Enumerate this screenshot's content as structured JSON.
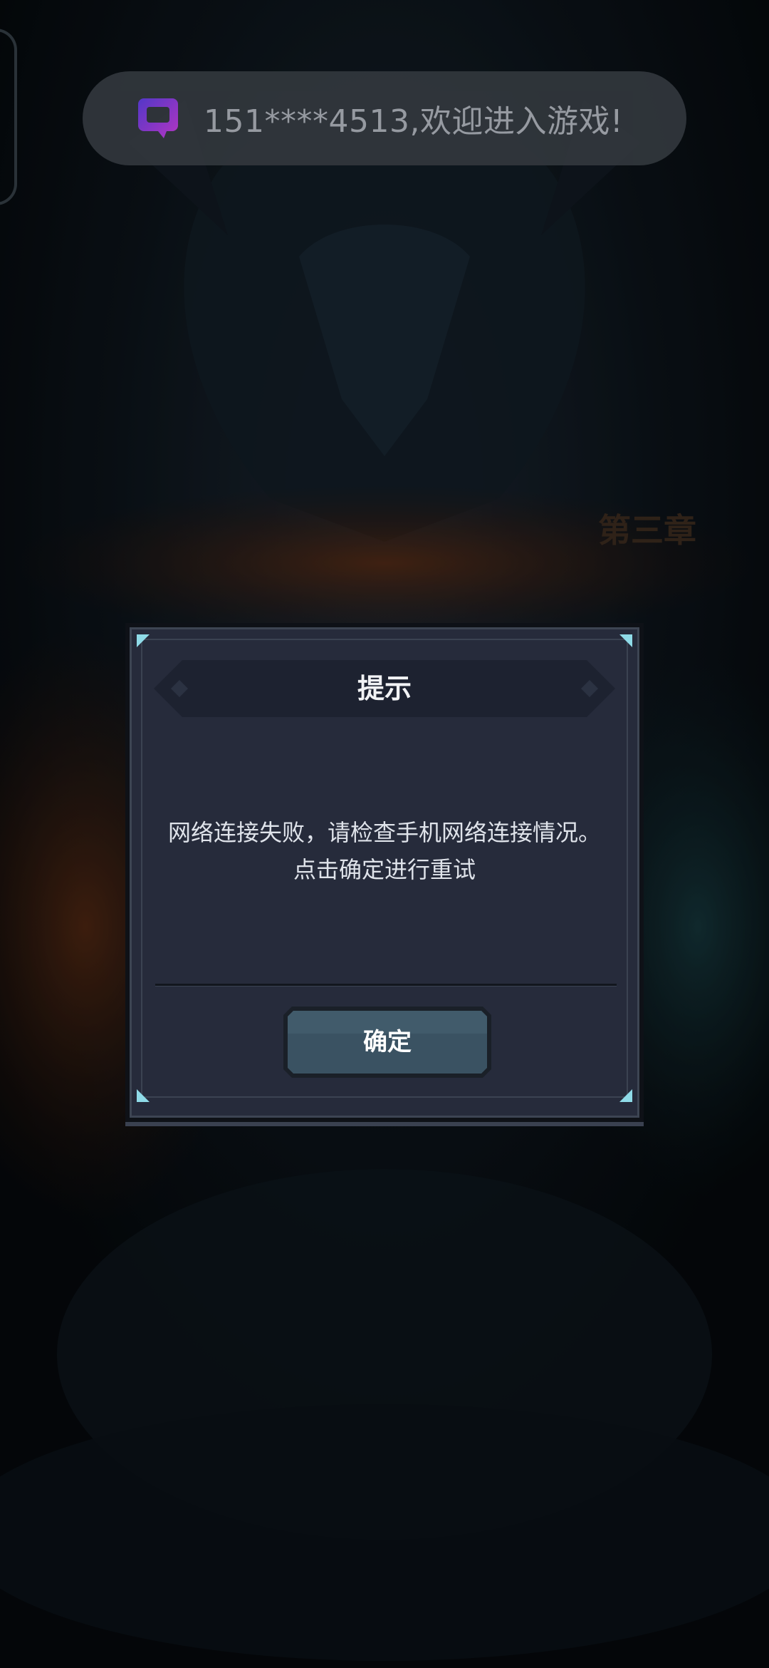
{
  "toast": {
    "message": "151****4513,欢迎进入游戏!",
    "logo_icon": "q-logo-icon",
    "colors": {
      "background": "#32373d",
      "text": "#a2a6ad",
      "logo_start": "#5a3bd8",
      "logo_end": "#c03ad0"
    }
  },
  "background": {
    "title_art_text": "第三章"
  },
  "dialog": {
    "title": "提示",
    "message_lines": [
      "网络连接失败，请检查手机网络连接情况。",
      "点击确定进行重试"
    ],
    "confirm_label": "确定",
    "colors": {
      "panel": "#262b3b",
      "title_bar": "#1d2230",
      "corner_accent": "#8fdbe8",
      "button_fill": "#3a5262",
      "button_border": "#1a2028",
      "text": "#dfe3ea"
    }
  }
}
